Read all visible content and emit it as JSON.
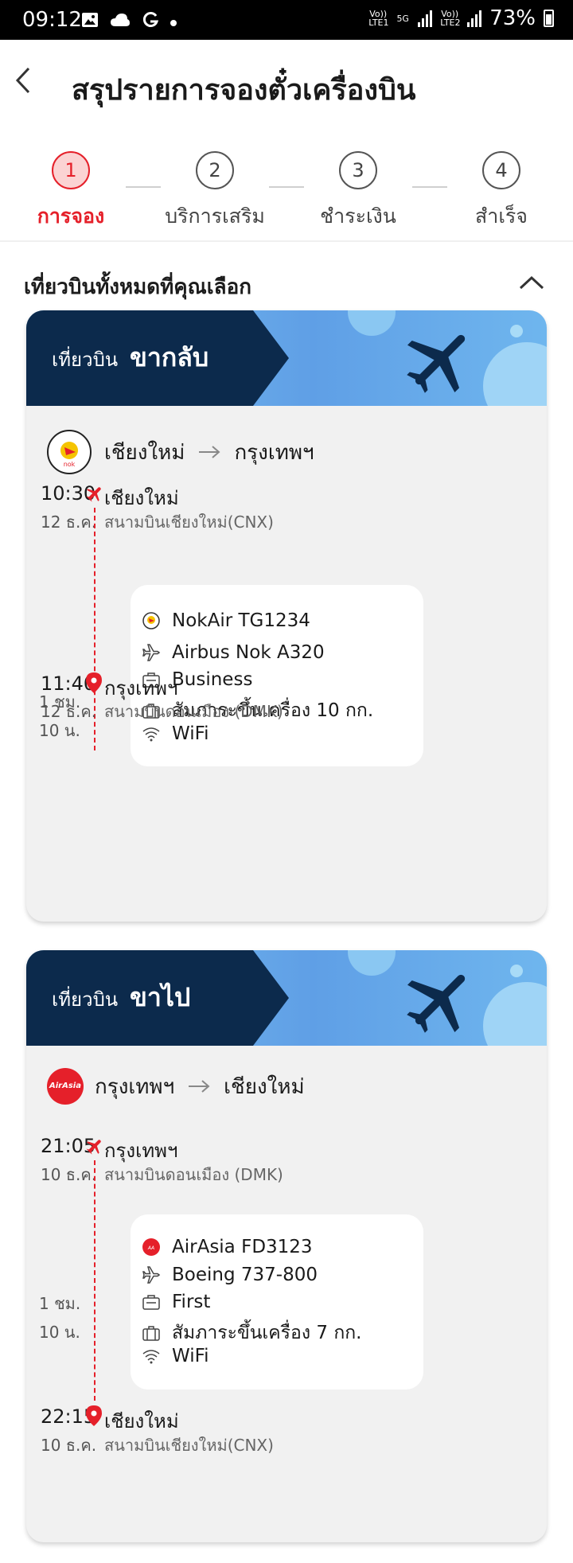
{
  "status_bar": {
    "time": "09:12",
    "sim1_label": "Vo)) LTE1",
    "network": "5G",
    "sim2_label": "Vo)) LTE2",
    "battery": "73%"
  },
  "header": {
    "title": "สรุปรายการจองตั๋วเครื่องบิน"
  },
  "stepper": [
    {
      "num": "1",
      "label": "การจอง",
      "active": true
    },
    {
      "num": "2",
      "label": "บริการเสริม",
      "active": false
    },
    {
      "num": "3",
      "label": "ชำระเงิน",
      "active": false
    },
    {
      "num": "4",
      "label": "สำเร็จ",
      "active": false
    }
  ],
  "section_title": "เที่ยวบินทั้งหมดที่คุณเลือก",
  "flights": [
    {
      "banner_small": "เที่ยวบิน",
      "banner_big": "ขากลับ",
      "from_city": "เชียงใหม่",
      "to_city": "กรุงเทพฯ",
      "logo": "nok-air-logo",
      "dep_time": "10:30",
      "dep_date": "12 ธ.ค.",
      "dep_city": "เชียงใหม่",
      "dep_airport": "สนามบินเชียงใหม่(CNX)",
      "duration_line1": "1 ชม.",
      "duration_line2": "10 น.",
      "flight_no": "NokAir TG1234",
      "aircraft": "Airbus Nok A320",
      "cabin": "Business",
      "baggage": "สัมภาระขึ้นเครื่อง 10 กก.",
      "wifi": "WiFi",
      "arr_time": "11:40",
      "arr_date": "12 ธ.ค.",
      "arr_city": "กรุงเทพฯ",
      "arr_airport": "สนามบินดอนเมือง (DMK)"
    },
    {
      "banner_small": "เที่ยวบิน",
      "banner_big": "ขาไป",
      "from_city": "กรุงเทพฯ",
      "to_city": "เชียงใหม่",
      "logo": "airasia-logo",
      "logo_text": "AirAsia",
      "dep_time": "21:05",
      "dep_date": "10 ธ.ค.",
      "dep_city": "กรุงเทพฯ",
      "dep_airport": "สนามบินดอนเมือง (DMK)",
      "duration_line1": "1 ชม.",
      "duration_line2": "10 น.",
      "flight_no": "AirAsia FD3123",
      "aircraft": "Boeing 737-800",
      "cabin": "First",
      "baggage": "สัมภาระขึ้นเครื่อง 7 กก.",
      "wifi": "WiFi",
      "arr_time": "22:15",
      "arr_date": "10 ธ.ค.",
      "arr_city": "เชียงใหม่",
      "arr_airport": "สนามบินเชียงใหม่(CNX)"
    }
  ],
  "colors": {
    "accent_red": "#e5202a",
    "banner_navy": "#0c2a4c",
    "banner_blue": "#5f9fe6",
    "card_bg": "#f1f1f1"
  }
}
